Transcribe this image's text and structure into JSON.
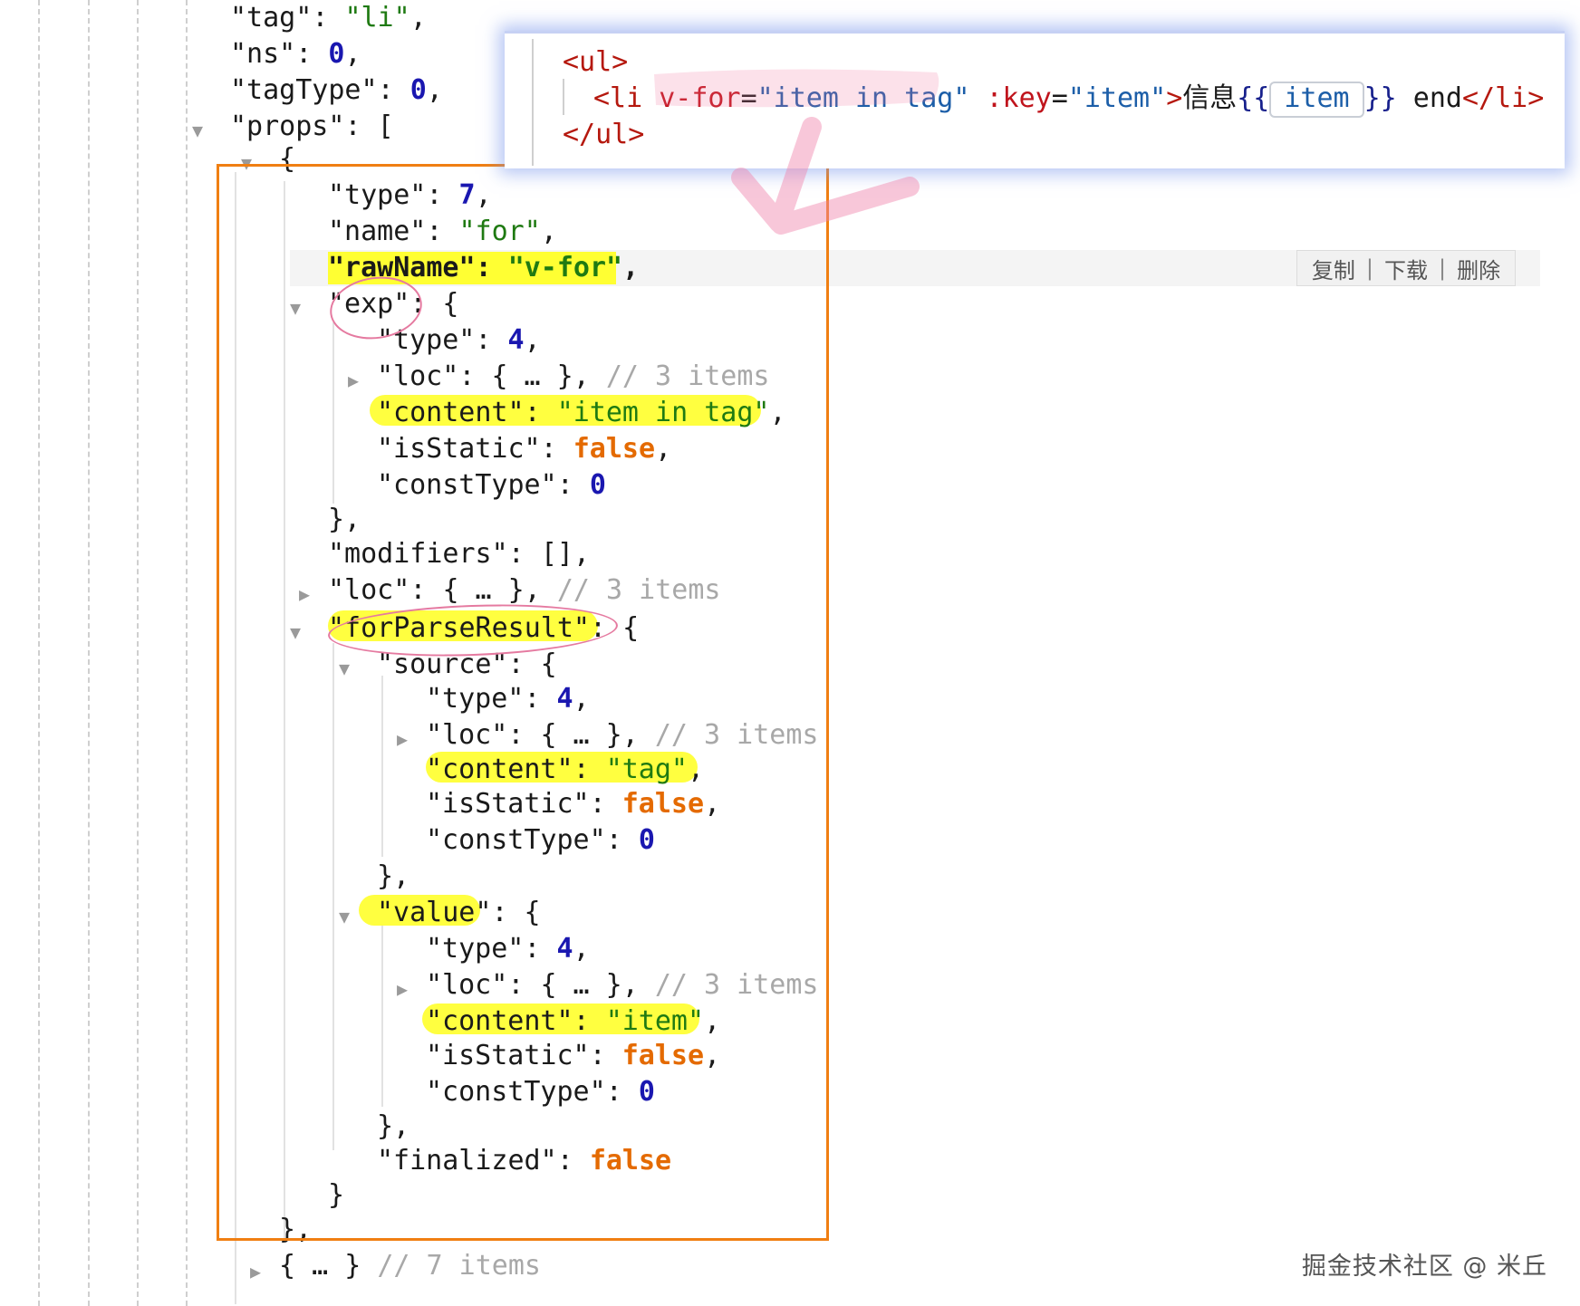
{
  "tree": {
    "top_lines": [
      {
        "key": "\"tag\"",
        "value": "\"li\"",
        "vtype": "str",
        "suffix": ","
      },
      {
        "key": "\"ns\"",
        "value": "0",
        "vtype": "num",
        "suffix": ","
      },
      {
        "key": "\"tagType\"",
        "value": "0",
        "vtype": "num",
        "suffix": ","
      },
      {
        "key": "\"props\"",
        "value": "[",
        "vtype": "p",
        "suffix": ""
      }
    ],
    "open_brace": "{",
    "prop": {
      "type": {
        "key": "\"type\"",
        "value": "7"
      },
      "name": {
        "key": "\"name\"",
        "value": "\"for\""
      },
      "rawName": {
        "key": "\"rawName\"",
        "value": "\"v-for\""
      },
      "exp": {
        "key": "\"exp\"",
        "type": {
          "key": "\"type\"",
          "value": "4"
        },
        "loc": {
          "key": "\"loc\"",
          "collapsed": "{ … }",
          "comment": "// 3 items"
        },
        "content": {
          "key": "\"content\"",
          "value": "\"item in tag\""
        },
        "isStatic": {
          "key": "\"isStatic\"",
          "value": "false"
        },
        "constType": {
          "key": "\"constType\"",
          "value": "0"
        }
      },
      "modifiers": {
        "key": "\"modifiers\"",
        "value": "[]"
      },
      "loc": {
        "key": "\"loc\"",
        "collapsed": "{ … }",
        "comment": "// 3 items"
      },
      "forParseResult": {
        "key": "\"forParseResult\"",
        "source": {
          "key": "\"source\"",
          "type": {
            "key": "\"type\"",
            "value": "4"
          },
          "loc": {
            "key": "\"loc\"",
            "collapsed": "{ … }",
            "comment": "// 3 items"
          },
          "content": {
            "key": "\"content\"",
            "value": "\"tag\""
          },
          "isStatic": {
            "key": "\"isStatic\"",
            "value": "false"
          },
          "constType": {
            "key": "\"constType\"",
            "value": "0"
          }
        },
        "value": {
          "key": "\"value\"",
          "type": {
            "key": "\"type\"",
            "value": "4"
          },
          "loc": {
            "key": "\"loc\"",
            "collapsed": "{ … }",
            "comment": "// 3 items"
          },
          "content": {
            "key": "\"content\"",
            "value": "\"item\""
          },
          "isStatic": {
            "key": "\"isStatic\"",
            "value": "false"
          },
          "constType": {
            "key": "\"constType\"",
            "value": "0"
          }
        },
        "finalized": {
          "key": "\"finalized\"",
          "value": "false"
        }
      }
    },
    "close_prop": "},",
    "next_prop": {
      "collapsed": "{ … }",
      "comment": "// 7 items"
    }
  },
  "code_panel": {
    "line1": "<ul>",
    "line2_open": "<li ",
    "line2_attr1": "v-for",
    "line2_val1": "\"item in tag\"",
    "line2_attr2": ":key",
    "line2_val2": "\"item\"",
    "line2_text": "信息",
    "line2_interp_open": "{{",
    "line2_interp_var": "item",
    "line2_interp_close": "}}",
    "line2_end_text": " end",
    "line2_close": "</li>",
    "line3": "</ul>"
  },
  "actions": {
    "copy": "复制",
    "download": "下载",
    "delete": "删除",
    "separator": "|"
  },
  "watermark": "掘金技术社区 @ 米丘",
  "colors": {
    "box_border": "#f07f12",
    "highlight": "#ffff40",
    "annotation_pink": "#e57aa0",
    "panel_glow": "#7896eb"
  }
}
